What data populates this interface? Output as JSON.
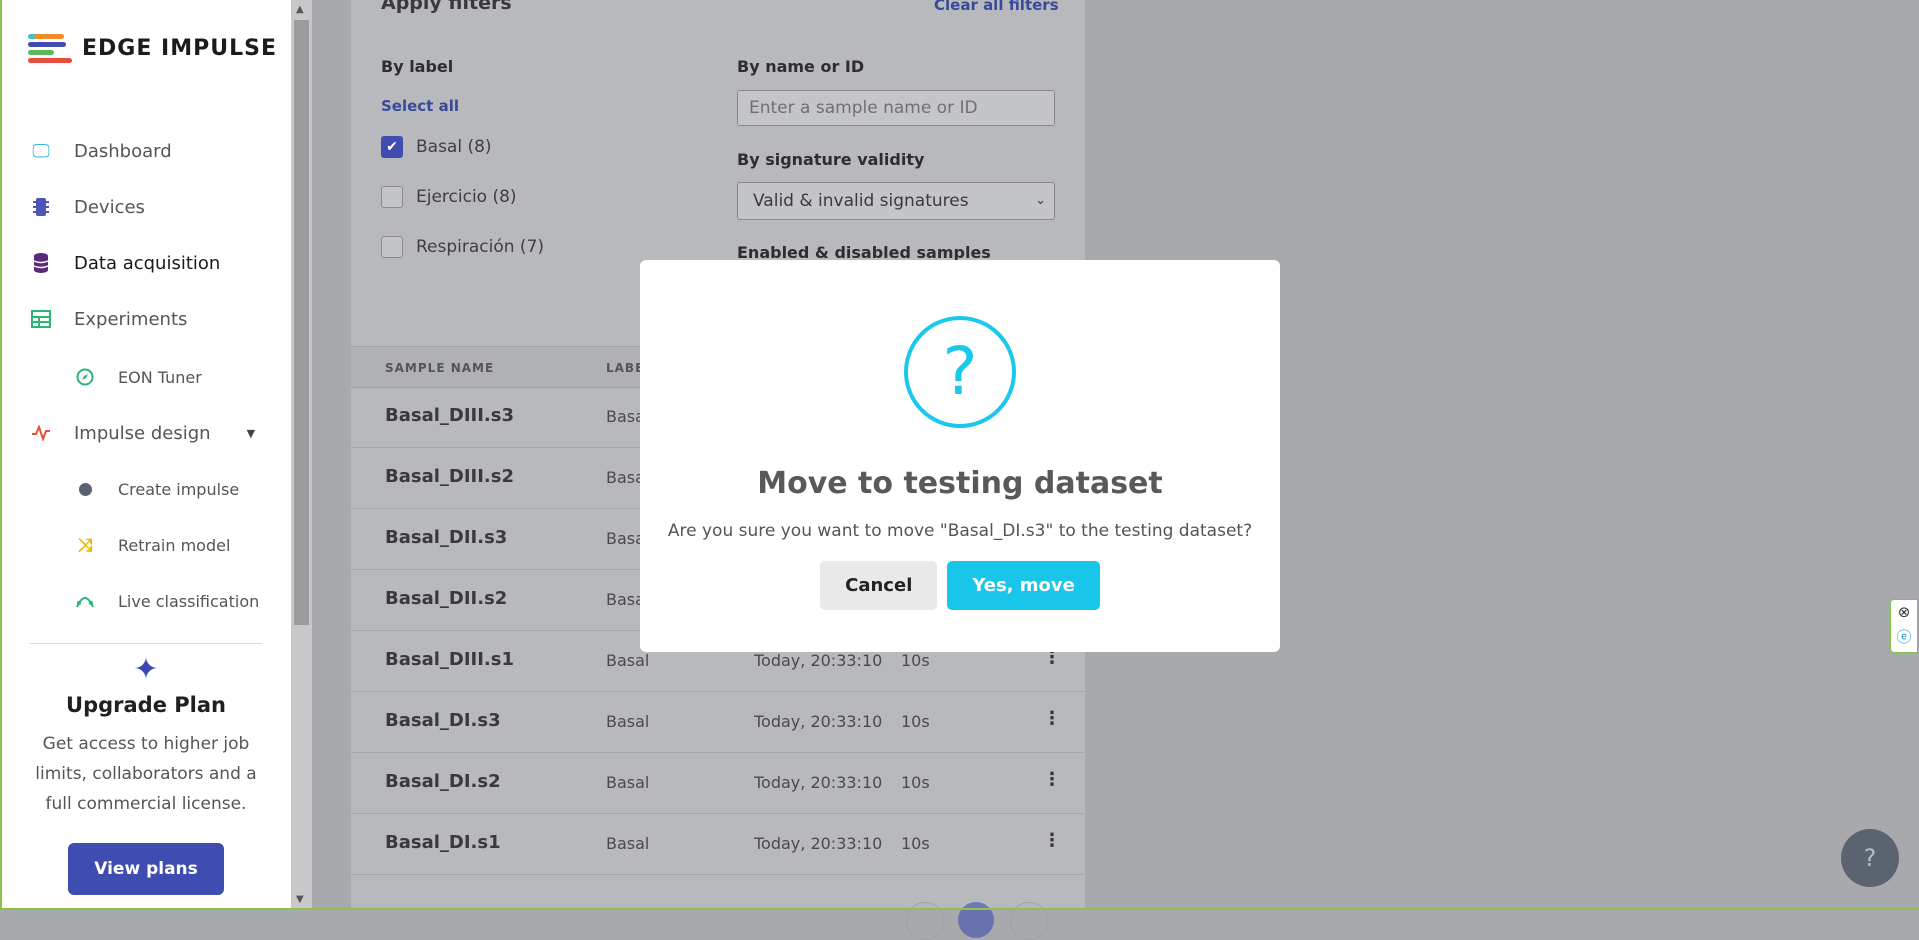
{
  "brand": {
    "name": "EDGE IMPULSE"
  },
  "sidebar": {
    "items": [
      {
        "label": "Dashboard",
        "icon": "monitor-icon"
      },
      {
        "label": "Devices",
        "icon": "chip-icon"
      },
      {
        "label": "Data acquisition",
        "icon": "database-icon"
      },
      {
        "label": "Experiments",
        "icon": "table-icon"
      },
      {
        "label": "EON Tuner",
        "icon": "compass-icon"
      },
      {
        "label": "Impulse design",
        "icon": "pulse-icon"
      },
      {
        "label": "Create impulse",
        "icon": "dot-icon"
      },
      {
        "label": "Retrain model",
        "icon": "shuffle-icon"
      },
      {
        "label": "Live classification",
        "icon": "signal-icon"
      }
    ],
    "upgrade": {
      "title": "Upgrade Plan",
      "text": "Get access to higher job limits, collaborators and a full commercial license.",
      "button": "View plans"
    }
  },
  "filters": {
    "title": "Apply filters",
    "clear": "Clear all filters",
    "by_label": "By label",
    "select_all": "Select all",
    "labels": [
      {
        "text": "Basal (8)",
        "checked": true
      },
      {
        "text": "Ejercicio (8)",
        "checked": false
      },
      {
        "text": "Respiración (7)",
        "checked": false
      }
    ],
    "by_name": "By name or ID",
    "name_placeholder": "Enter a sample name or ID",
    "by_signature": "By signature validity",
    "signature_value": "Valid & invalid signatures",
    "enabled_label": "Enabled & disabled samples"
  },
  "table": {
    "headers": [
      "SAMPLE NAME",
      "LABEL"
    ],
    "rows": [
      {
        "name": "Basal_DIII.s3",
        "label": "Basal",
        "date": "",
        "length": ""
      },
      {
        "name": "Basal_DIII.s2",
        "label": "Basal",
        "date": "",
        "length": ""
      },
      {
        "name": "Basal_DII.s3",
        "label": "Basal",
        "date": "",
        "length": ""
      },
      {
        "name": "Basal_DII.s2",
        "label": "Basal",
        "date": "",
        "length": ""
      },
      {
        "name": "Basal_DIII.s1",
        "label": "Basal",
        "date": "Today, 20:33:10",
        "length": "10s"
      },
      {
        "name": "Basal_DI.s3",
        "label": "Basal",
        "date": "Today, 20:33:10",
        "length": "10s"
      },
      {
        "name": "Basal_DI.s2",
        "label": "Basal",
        "date": "Today, 20:33:10",
        "length": "10s"
      },
      {
        "name": "Basal_DI.s1",
        "label": "Basal",
        "date": "Today, 20:33:10",
        "length": "10s"
      }
    ]
  },
  "modal": {
    "icon": "question-icon",
    "title": "Move to testing dataset",
    "message": "Are you sure you want to move \"Basal_DI.s3\" to the testing dataset?",
    "cancel": "Cancel",
    "confirm": "Yes, move"
  },
  "colors": {
    "accent": "#1ac5ea",
    "brand": "#3f4db1"
  }
}
